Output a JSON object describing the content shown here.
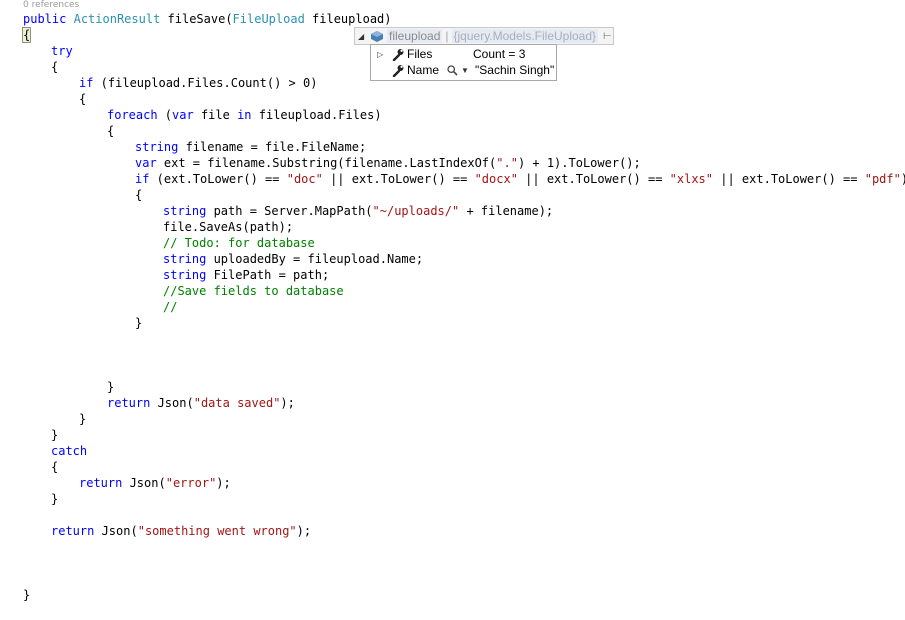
{
  "editor": {
    "codelens": "0 references",
    "signature": {
      "kw1": "public",
      "type": "ActionResult",
      "name": " fileSave(",
      "ptype": "FileUpload",
      "rest": " fileupload)"
    },
    "lines": {
      "l_open": "{",
      "l_try": "try",
      "l_ob1": "{",
      "l_if1_kw": "if",
      "l_if1_rest": " (fileupload.Files.Count() > 0)",
      "l_ob2": "{",
      "l_foreach_kw": "foreach",
      "l_foreach_p": " (",
      "l_foreach_var": "var",
      "l_foreach_mid": " file ",
      "l_foreach_in": "in",
      "l_foreach_rest": " fileupload.Files)",
      "l_ob3": "{",
      "l_str1_kw": "string",
      "l_str1_rest": " filename = file.FileName;",
      "l_var_kw": "var",
      "l_var_a": " ext = filename.Substring(filename.LastIndexOf(",
      "l_var_s": "\".\"",
      "l_var_b": ") + 1).ToLower();",
      "l_if2_kw": "if",
      "l_if2_a": " (ext.ToLower() == ",
      "l_if2_s1": "\"doc\"",
      "l_if2_b": " || ext.ToLower() == ",
      "l_if2_s2": "\"docx\"",
      "l_if2_c": " || ext.ToLower() == ",
      "l_if2_s3": "\"xlxs\"",
      "l_if2_d": " || ext.ToLower() == ",
      "l_if2_s4": "\"pdf\"",
      "l_if2_e": ")",
      "l_ob4": "{",
      "l_path_kw": "string",
      "l_path_a": " path = Server.MapPath(",
      "l_path_s": "\"~/uploads/\"",
      "l_path_b": " + filename);",
      "l_save": "file.SaveAs(path);",
      "l_todo": "// Todo: for database",
      "l_up_kw": "string",
      "l_up_rest": " uploadedBy = fileupload.Name;",
      "l_fp_kw": "string",
      "l_fp_rest": " FilePath = path;",
      "l_cm2": "//Save fields to database",
      "l_cm3": "//",
      "l_cb4": "}",
      "l_cb3": "}",
      "l_ret1_kw": "return",
      "l_ret1_a": " Json(",
      "l_ret1_s": "\"data saved\"",
      "l_ret1_b": ");",
      "l_cb2": "}",
      "l_cb1": "}",
      "l_catch": "catch",
      "l_ob5": "{",
      "l_ret2_kw": "return",
      "l_ret2_a": " Json(",
      "l_ret2_s": "\"error\"",
      "l_ret2_b": ");",
      "l_cb5": "}",
      "l_ret3_kw": "return",
      "l_ret3_a": " Json(",
      "l_ret3_s": "\"something went wrong\"",
      "l_ret3_b": ");",
      "l_close": "}"
    }
  },
  "datatip": {
    "name": "fileupload",
    "sep": "|",
    "value": "{jquery.Models.FileUpload}",
    "rows": [
      {
        "name": "Files",
        "value": "Count = 3"
      },
      {
        "name": "Name",
        "value": "\"Sachin Singh\""
      }
    ],
    "icons": [
      "object-icon",
      "wrench-icon",
      "magnifier-icon",
      "pin-icon"
    ]
  },
  "colors": {
    "keyword": "#0000ff",
    "type": "#2b91af",
    "string": "#a31515",
    "comment": "#008000"
  }
}
